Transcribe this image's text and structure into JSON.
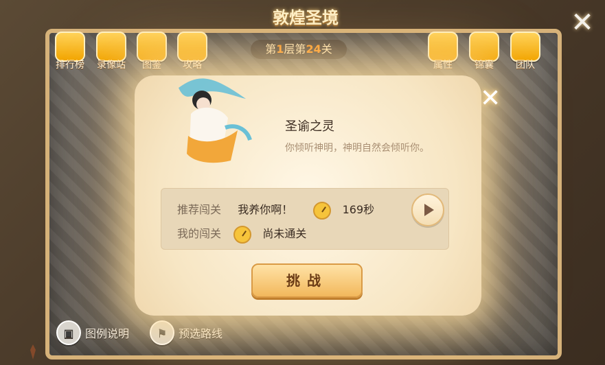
{
  "window": {
    "title": "敦煌圣境",
    "close_symbol": "✕"
  },
  "level_indicator": {
    "prefix": "第",
    "layer": "1",
    "middle": "层第",
    "stage": "24",
    "suffix": "关"
  },
  "top_left_icons": [
    {
      "label": "排行榜",
      "icon": "trophy-icon"
    },
    {
      "label": "录像站",
      "icon": "video-icon"
    },
    {
      "label": "图鉴",
      "icon": "book-icon"
    },
    {
      "label": "攻略",
      "icon": "guide-icon"
    }
  ],
  "top_right_icons": [
    {
      "label": "属性",
      "icon": "attribute-icon"
    },
    {
      "label": "锦囊",
      "icon": "bag-icon"
    },
    {
      "label": "团队",
      "icon": "team-icon"
    }
  ],
  "bottom_buttons": {
    "legend": {
      "label": "图例说明",
      "icon": "image-icon"
    },
    "route": {
      "label": "预选路线",
      "icon": "flag-icon"
    }
  },
  "modal": {
    "close_symbol": "✕",
    "title": "圣谕之灵",
    "description": "你倾听神明，神明自然会倾听你。",
    "recommended_label": "推荐闯关",
    "recommended_player": "我养你啊！",
    "recommended_time": "169秒",
    "my_label": "我的闯关",
    "my_status": "尚未通关",
    "challenge_label": "挑战"
  },
  "colors": {
    "board_border": "#d6b27a",
    "modal_bg": "#fff7e6",
    "accent_orange": "#ff9b2a",
    "button_gold": "#f2b85c"
  }
}
